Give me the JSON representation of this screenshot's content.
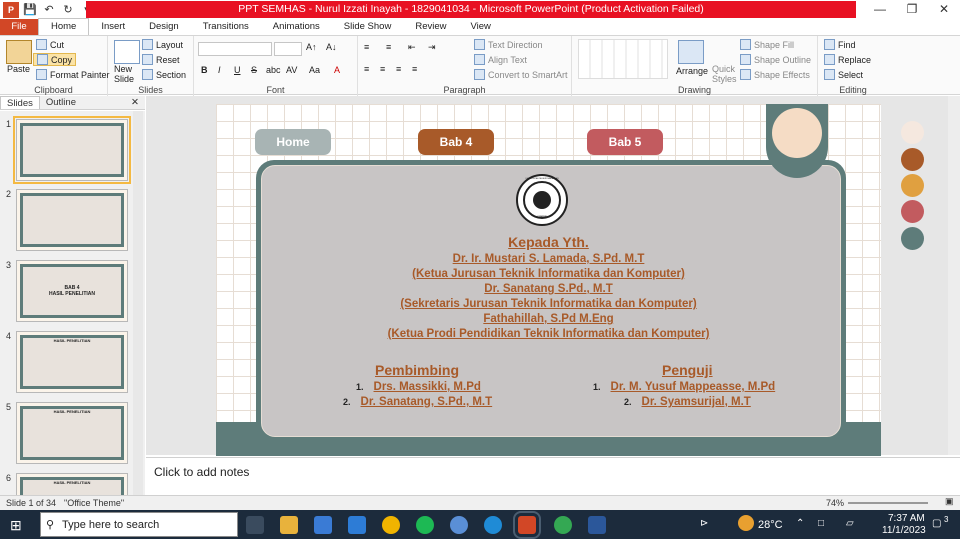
{
  "window": {
    "title": "PPT SEMHAS - Nurul Izzati Inayah - 1829041034  -  Microsoft PowerPoint (Product Activation Failed)"
  },
  "ribbon_tabs": [
    "File",
    "Home",
    "Insert",
    "Design",
    "Transitions",
    "Animations",
    "Slide Show",
    "Review",
    "View"
  ],
  "clipboard": {
    "paste": "Paste",
    "cut": "Cut",
    "copy": "Copy",
    "format_painter": "Format Painter",
    "label": "Clipboard"
  },
  "slides_grp": {
    "new_slide": "New Slide",
    "layout": "Layout",
    "reset": "Reset",
    "section": "Section",
    "label": "Slides"
  },
  "font_grp": {
    "label": "Font",
    "bold": "B",
    "italic": "I",
    "underline": "U",
    "strike": "S",
    "shadow": "abc",
    "spacing": "AV",
    "case": "Aa",
    "color": "A"
  },
  "para_grp": {
    "text_direction": "Text Direction",
    "align_text": "Align Text",
    "convert": "Convert to SmartArt",
    "label": "Paragraph"
  },
  "drawing": {
    "arrange": "Arrange",
    "quick_styles": "Quick Styles",
    "shape_fill": "Shape Fill",
    "shape_outline": "Shape Outline",
    "shape_effects": "Shape Effects",
    "label": "Drawing"
  },
  "editing": {
    "find": "Find",
    "replace": "Replace",
    "select": "Select",
    "label": "Editing"
  },
  "pane": {
    "tab_slides": "Slides",
    "tab_outline": "Outline",
    "numbers": [
      "1",
      "2",
      "3",
      "4",
      "5",
      "6"
    ]
  },
  "thumbs": {
    "s3a": "BAB 4",
    "s3b": "HASIL PENELITIAN",
    "hasil": "HASIL PENELITIAN"
  },
  "slide": {
    "nav": [
      "Home",
      "Bab 4",
      "Bab 5"
    ],
    "kepada": "Kepada Yth.",
    "lines": [
      "Dr. Ir. Mustari S. Lamada, S.Pd. M.T",
      "(Ketua Jurusan Teknik Informatika dan Komputer)",
      "Dr. Sanatang S.Pd., M.T",
      "(Sekretaris Jurusan Teknik Informatika dan Komputer)",
      "Fathahillah, S.Pd M.Eng",
      "(Ketua Prodi Pendidikan Teknik Informatika dan Komputer)"
    ],
    "pembimbing_title": "Pembimbing",
    "pembimbing": [
      {
        "n": "1.",
        "name": "Drs. Massikki, M.Pd"
      },
      {
        "n": "2.",
        "name": "Dr. Sanatang, S.Pd., M.T"
      }
    ],
    "penguji_title": "Penguji",
    "penguji": [
      {
        "n": "1.",
        "name": "Dr. M. Yusuf Mappeasse, M.Pd"
      },
      {
        "n": "2.",
        "name": "Dr. Syamsurijal, M.T"
      }
    ],
    "logo_text": "UNIVERSITAS NEGERI MAKASSAR",
    "logo_abbr": "UNM"
  },
  "colors": {
    "brown": "#a85a29",
    "teal": "#5e7c7a",
    "peach": "#f5dcc5",
    "orange": "#e0a040",
    "rose": "#c25b5f",
    "grey": "#a8b4b4"
  },
  "notes": {
    "placeholder": "Click to add notes"
  },
  "status": {
    "slide": "Slide 1 of 34",
    "theme": "\"Office Theme\"",
    "zoom": "74%"
  },
  "taskbar": {
    "search": "Type here to search",
    "temp": "28°C",
    "time": "7:37 AM",
    "date": "11/1/2023",
    "badge": "3"
  }
}
